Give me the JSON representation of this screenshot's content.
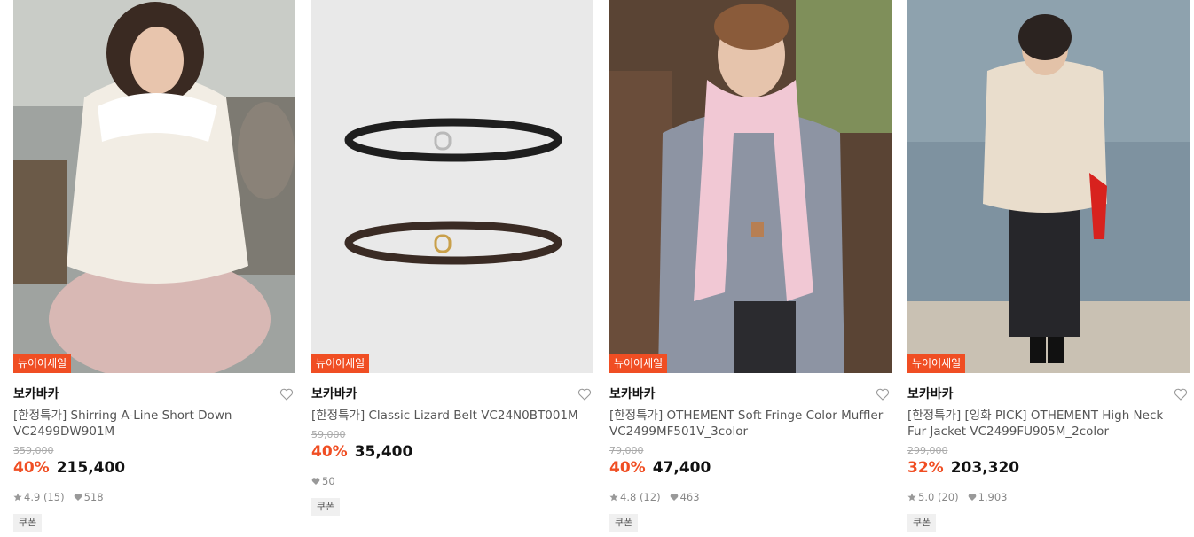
{
  "products": [
    {
      "badge": "뉴이어세일",
      "brand": "보카바카",
      "title": "[한정특가] Shirring A-Line Short Down VC2499DW901M",
      "original_price": "359,000",
      "discount": "40%",
      "price": "215,400",
      "rating": "4.9 (15)",
      "likes": "518",
      "coupon": "쿠폰",
      "image": "woman in white puffer down jacket"
    },
    {
      "badge": "뉴이어세일",
      "brand": "보카바카",
      "title": "[한정특가] Classic Lizard Belt VC24N0BT001M",
      "original_price": "59,000",
      "discount": "40%",
      "price": "35,400",
      "likes": "50",
      "coupon": "쿠폰",
      "image": "two leather belts black and brown"
    },
    {
      "badge": "뉴이어세일",
      "brand": "보카바카",
      "title": "[한정특가] OTHEMENT Soft Fringe Color Muffler VC2499MF501V_3color",
      "original_price": "79,000",
      "discount": "40%",
      "price": "47,400",
      "rating": "4.8 (12)",
      "likes": "463",
      "coupon": "쿠폰",
      "image": "woman wearing pink fringe muffler"
    },
    {
      "badge": "뉴이어세일",
      "brand": "보카바카",
      "title": "[한정특가] [잉화 PICK] OTHEMENT High Neck Fur Jacket VC2499FU905M_2color",
      "original_price": "299,000",
      "discount": "32%",
      "price": "203,320",
      "rating": "5.0 (20)",
      "likes": "1,903",
      "coupon": "쿠폰",
      "image": "woman in cream fur jacket and black skirt"
    }
  ],
  "colors": {
    "accent": "#f04e23"
  }
}
